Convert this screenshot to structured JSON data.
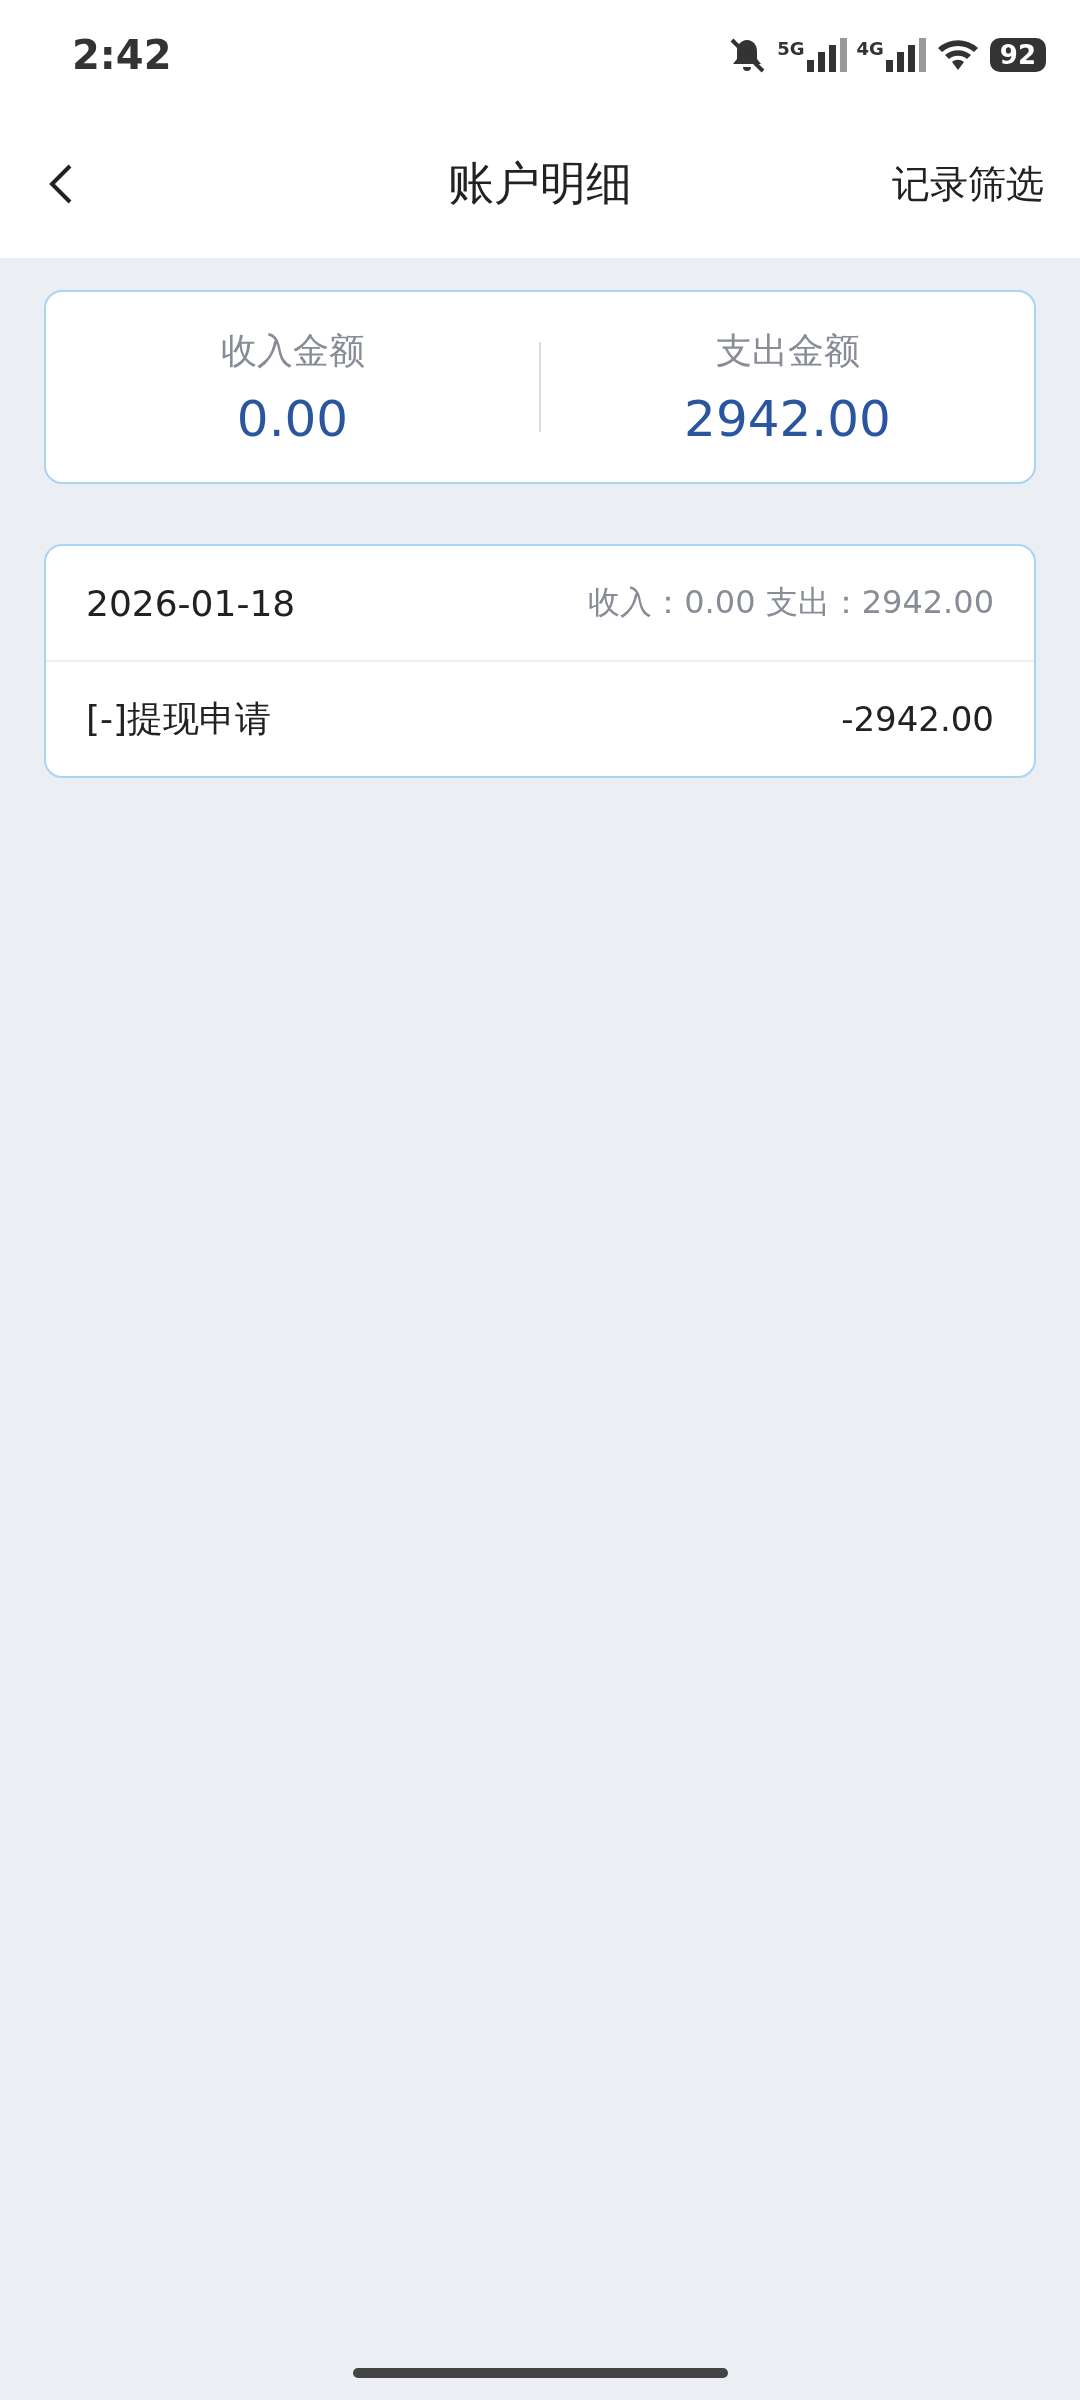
{
  "status_bar": {
    "time": "2:42",
    "networks": [
      "5G",
      "4G"
    ],
    "battery": "92"
  },
  "header": {
    "title": "账户明细",
    "action": "记录筛选"
  },
  "summary": [
    {
      "label": "收入金额",
      "amount": "0.00"
    },
    {
      "label": "支出金额",
      "amount": "2942.00"
    }
  ],
  "days": [
    {
      "date": "2026-01-18",
      "totals": "收入：0.00 支出：2942.00",
      "records": [
        {
          "title": "[-]提现申请",
          "amount": "-2942.00"
        }
      ]
    }
  ]
}
